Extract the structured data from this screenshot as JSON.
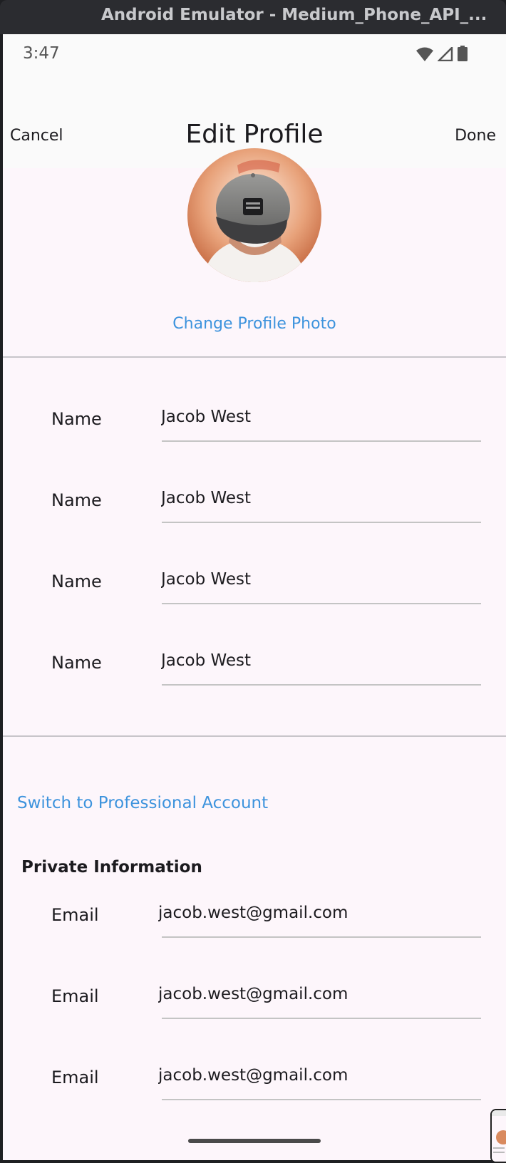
{
  "window": {
    "title": "Android Emulator - Medium_Phone_API_..."
  },
  "status_bar": {
    "time": "3:47",
    "icons": [
      "wifi-icon",
      "signal-icon",
      "battery-icon"
    ]
  },
  "app_bar": {
    "cancel_label": "Cancel",
    "title": "Edit Profile",
    "done_label": "Done"
  },
  "profile": {
    "change_photo_label": "Change Profile Photo"
  },
  "public_fields": [
    {
      "label": "Name",
      "value": "Jacob West"
    },
    {
      "label": "Name",
      "value": "Jacob West"
    },
    {
      "label": "Name",
      "value": "Jacob West"
    },
    {
      "label": "Name",
      "value": "Jacob West"
    }
  ],
  "switch_professional_label": "Switch to Professional Account",
  "private_section": {
    "header": "Private Information",
    "fields": [
      {
        "label": "Email",
        "value": "jacob.west@gmail.com"
      },
      {
        "label": "Email",
        "value": "jacob.west@gmail.com"
      },
      {
        "label": "Email",
        "value": "jacob.west@gmail.com"
      }
    ]
  },
  "colors": {
    "accent_link": "#3d93dd",
    "background": "#fdf6fb",
    "app_bar": "#fafafa",
    "text": "#1c1b1f"
  }
}
